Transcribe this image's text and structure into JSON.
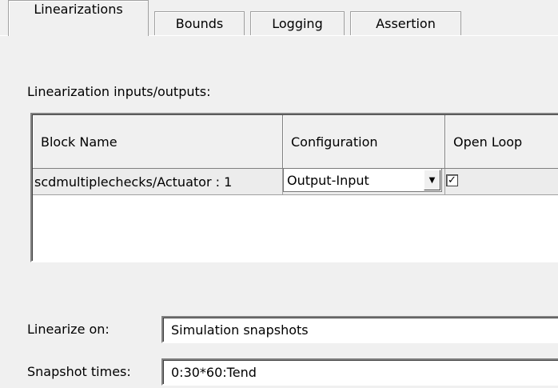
{
  "tabs": [
    {
      "label": "Linearizations",
      "active": true
    },
    {
      "label": "Bounds",
      "active": false
    },
    {
      "label": "Logging",
      "active": false
    },
    {
      "label": "Assertion",
      "active": false
    }
  ],
  "io_section": {
    "label": "Linearization inputs/outputs:",
    "columns": [
      "Block Name",
      "Configuration",
      "Open Loop"
    ],
    "rows": [
      {
        "block_name": "scdmultiplechecks/Actuator : 1",
        "configuration": "Output-Input",
        "open_loop": true,
        "open_loop_glyph": "✓"
      }
    ]
  },
  "icons": {
    "dropdown": "chevron-down-icon",
    "dropdown_glyph": "▼"
  },
  "form": {
    "linearize_on_label": "Linearize on:",
    "linearize_on_value": "Simulation snapshots",
    "snapshot_times_label": "Snapshot times:",
    "snapshot_times_value": "0:30*60:Tend"
  }
}
